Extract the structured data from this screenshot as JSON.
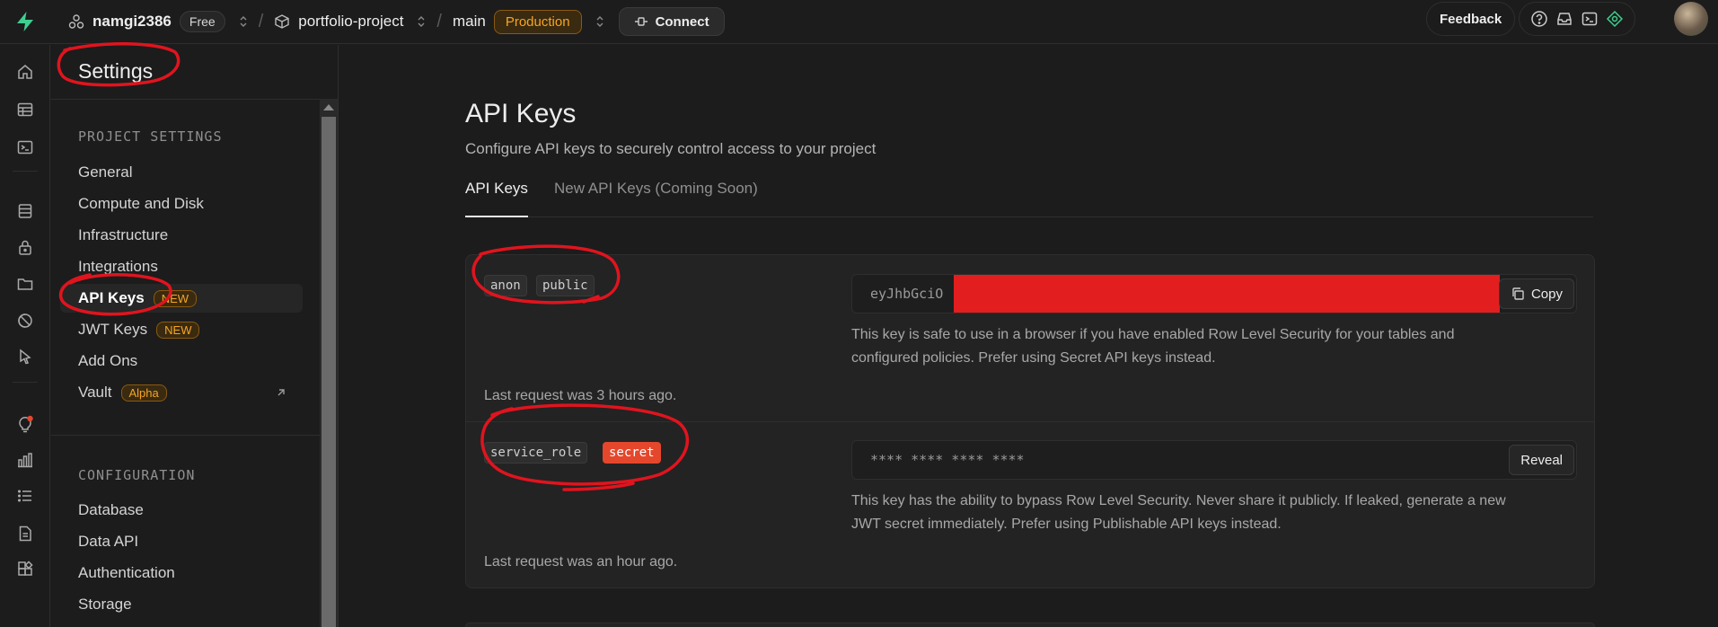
{
  "topbar": {
    "org_name": "namgi2386",
    "org_plan": "Free",
    "project_name": "portfolio-project",
    "branch_name": "main",
    "branch_env": "Production",
    "connect_label": "Connect",
    "feedback_label": "Feedback"
  },
  "rail_icons": [
    "home-icon",
    "table-editor-icon",
    "sql-editor-icon",
    "database-icon",
    "auth-icon",
    "storage-icon",
    "realtime-icon",
    "edge-functions-icon",
    "advisors-icon",
    "reports-icon",
    "logs-icon",
    "api-docs-icon",
    "integrations-icon"
  ],
  "sidebar": {
    "title": "Settings",
    "project_settings_heading": "PROJECT SETTINGS",
    "project_items": [
      {
        "label": "General"
      },
      {
        "label": "Compute and Disk"
      },
      {
        "label": "Infrastructure"
      },
      {
        "label": "Integrations"
      },
      {
        "label": "API Keys",
        "tag": "NEW"
      },
      {
        "label": "JWT Keys",
        "tag": "NEW"
      },
      {
        "label": "Add Ons"
      },
      {
        "label": "Vault",
        "tag": "Alpha"
      }
    ],
    "configuration_heading": "CONFIGURATION",
    "config_items": [
      {
        "label": "Database"
      },
      {
        "label": "Data API"
      },
      {
        "label": "Authentication"
      },
      {
        "label": "Storage"
      }
    ]
  },
  "main": {
    "title": "API Keys",
    "subtitle": "Configure API keys to securely control access to your project",
    "tabs": [
      {
        "label": "API Keys"
      },
      {
        "label": "New API Keys (Coming Soon)"
      }
    ],
    "keys": [
      {
        "chip1": "anon",
        "chip2": "public",
        "key_prefix": "eyJhbGciO",
        "button": "Copy",
        "description_1": "This key is safe to use in a browser if you have enabled Row Level Security for your tables and",
        "description_2": "configured policies. Prefer using Secret API keys instead.",
        "last_request": "Last request was 3 hours ago."
      },
      {
        "chip1": "service_role",
        "chip2": "secret",
        "key_masked": "**** **** **** ****",
        "button": "Reveal",
        "description_1": "This key has the ability to bypass Row Level Security. Never share it publicly. If leaked, generate a new",
        "description_2": "JWT secret immediately. Prefer using Publishable API keys instead.",
        "last_request": "Last request was an hour ago."
      }
    ]
  },
  "colors": {
    "background": "#1c1c1c",
    "accent_brand": "#3ecf8e",
    "production": "#f5a524",
    "secret_chip": "#e5472c",
    "redaction": "#e31e1e",
    "annotation": "#e0141e"
  }
}
